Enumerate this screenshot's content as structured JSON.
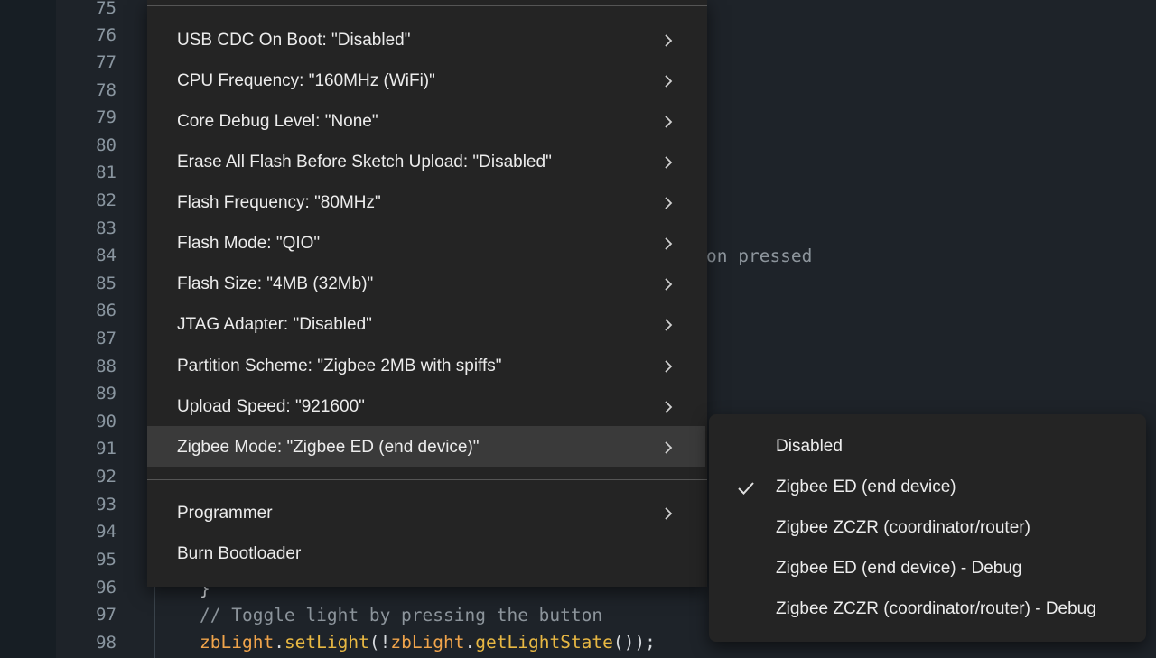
{
  "editor": {
    "line_numbers": [
      "75",
      "76",
      "77",
      "78",
      "79",
      "80",
      "81",
      "82",
      "83",
      "84",
      "85",
      "86",
      "87",
      "88",
      "89",
      "90",
      "91",
      "92",
      "93",
      "94",
      "95",
      "96",
      "97",
      "98"
    ],
    "fragment_pressed": "on pressed",
    "brace_line": "}",
    "comment_line": "// Toggle light by pressing the button",
    "call_line": {
      "obj1": "zbLight",
      "dot1": ".",
      "fn1": "setLight",
      "mid": "(!",
      "obj2": "zbLight",
      "dot2": ".",
      "fn2": "getLightState",
      "end": "());"
    }
  },
  "menu": {
    "items": [
      {
        "label": "USB CDC On Boot: \"Disabled\""
      },
      {
        "label": "CPU Frequency: \"160MHz (WiFi)\""
      },
      {
        "label": "Core Debug Level: \"None\""
      },
      {
        "label": "Erase All Flash Before Sketch Upload: \"Disabled\""
      },
      {
        "label": "Flash Frequency: \"80MHz\""
      },
      {
        "label": "Flash Mode: \"QIO\""
      },
      {
        "label": "Flash Size: \"4MB (32Mb)\""
      },
      {
        "label": "JTAG Adapter: \"Disabled\""
      },
      {
        "label": "Partition Scheme: \"Zigbee 2MB with spiffs\""
      },
      {
        "label": "Upload Speed: \"921600\""
      },
      {
        "label": "Zigbee Mode: \"Zigbee ED (end device)\""
      }
    ],
    "tools": [
      {
        "label": "Programmer"
      },
      {
        "label": "Burn Bootloader"
      }
    ],
    "submenu_icon": "chevron-right-icon"
  },
  "submenu": {
    "items": [
      {
        "label": "Disabled",
        "checked": false
      },
      {
        "label": "Zigbee ED (end device)",
        "checked": true
      },
      {
        "label": "Zigbee ZCZR (coordinator/router)",
        "checked": false
      },
      {
        "label": "Zigbee ED (end device) - Debug",
        "checked": false
      },
      {
        "label": "Zigbee ZCZR (coordinator/router) - Debug",
        "checked": false
      }
    ],
    "check_icon": "checkmark-icon"
  },
  "colors": {
    "editor_bg": "#1e2329",
    "menu_bg": "#242424",
    "menu_hover": "#3a3a3a",
    "comment": "#8d959c",
    "identifier": "#f0a44b",
    "function": "#e8b843"
  }
}
